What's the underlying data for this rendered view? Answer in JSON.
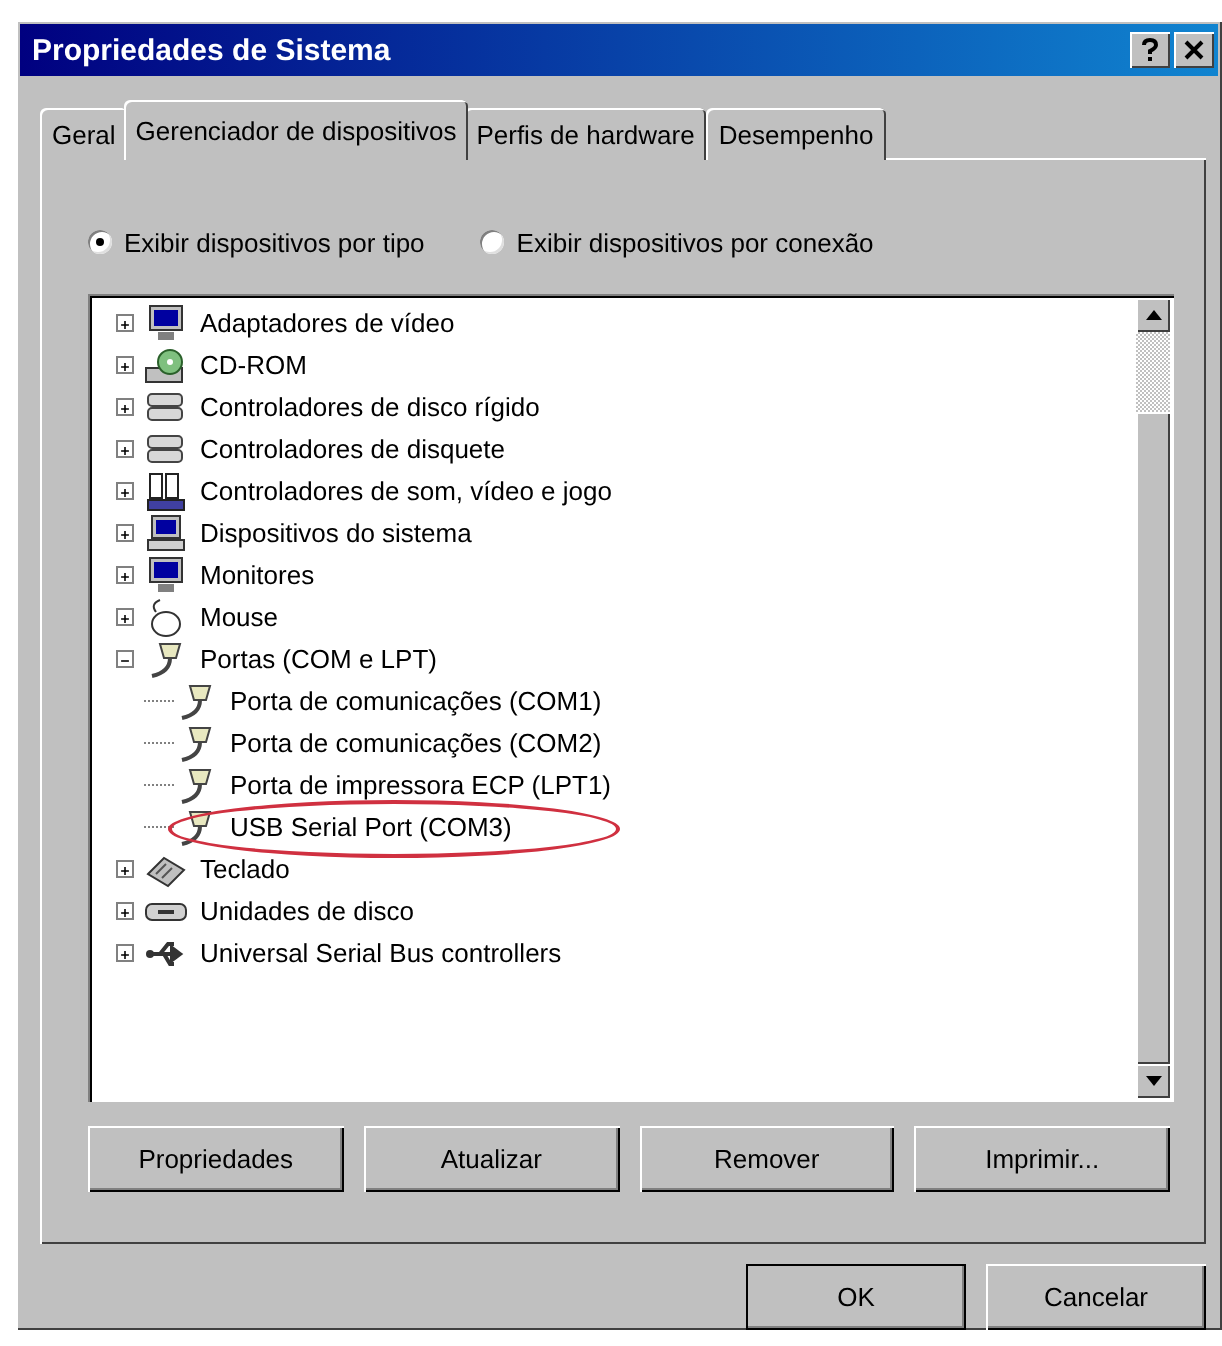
{
  "window": {
    "title": "Propriedades de Sistema"
  },
  "tabs": [
    {
      "label": "Geral",
      "selected": false
    },
    {
      "label": "Gerenciador de dispositivos",
      "selected": true
    },
    {
      "label": "Perfis de hardware",
      "selected": false
    },
    {
      "label": "Desempenho",
      "selected": false
    }
  ],
  "view_options": [
    {
      "label": "Exibir dispositivos por tipo",
      "selected": true
    },
    {
      "label": "Exibir dispositivos por conexão",
      "selected": false
    }
  ],
  "devices": [
    {
      "label": "Adaptadores de vídeo",
      "kind": "display",
      "expanded": false
    },
    {
      "label": "CD-ROM",
      "kind": "cdrom",
      "expanded": false
    },
    {
      "label": "Controladores de disco rígido",
      "kind": "disk",
      "expanded": false
    },
    {
      "label": "Controladores de disquete",
      "kind": "disk",
      "expanded": false
    },
    {
      "label": "Controladores de som, vídeo e jogo",
      "kind": "sound",
      "expanded": false
    },
    {
      "label": "Dispositivos do sistema",
      "kind": "computer",
      "expanded": false
    },
    {
      "label": "Monitores",
      "kind": "display",
      "expanded": false
    },
    {
      "label": "Mouse",
      "kind": "mouse",
      "expanded": false
    },
    {
      "label": "Portas (COM e LPT)",
      "kind": "port",
      "expanded": true,
      "children": [
        {
          "label": "Porta de comunicações (COM1)",
          "kind": "port",
          "circled": false
        },
        {
          "label": "Porta de comunicações (COM2)",
          "kind": "port",
          "circled": false
        },
        {
          "label": "Porta de impressora ECP (LPT1)",
          "kind": "port",
          "circled": false
        },
        {
          "label": "USB Serial Port (COM3)",
          "kind": "port",
          "circled": true
        }
      ]
    },
    {
      "label": "Teclado",
      "kind": "keyboard",
      "expanded": false
    },
    {
      "label": "Unidades de disco",
      "kind": "drive",
      "expanded": false
    },
    {
      "label": "Universal Serial Bus controllers",
      "kind": "usb",
      "expanded": false
    }
  ],
  "actions": [
    "Propriedades",
    "Atualizar",
    "Remover",
    "Imprimir..."
  ],
  "dialog_buttons": [
    "OK",
    "Cancelar"
  ]
}
